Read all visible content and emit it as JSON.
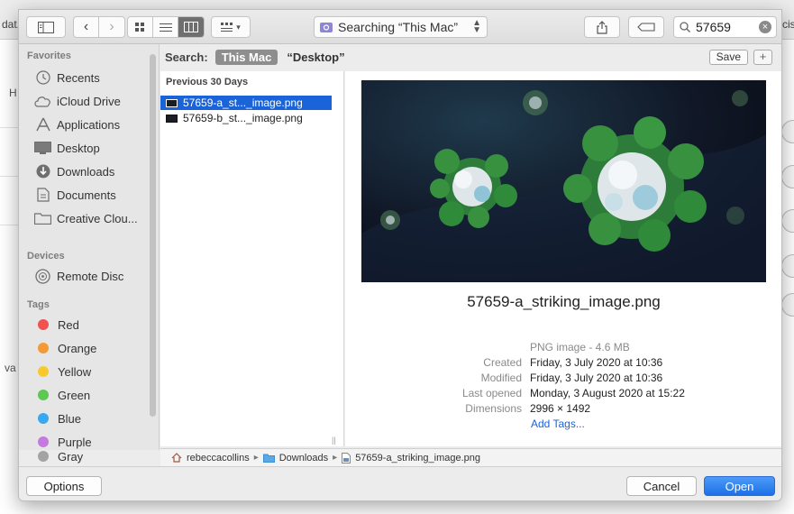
{
  "background": {
    "fragments": [
      "dat..",
      "cis"
    ],
    "left_fragments": [
      "H",
      "va"
    ]
  },
  "toolbar": {
    "location": "Searching “This Mac”",
    "search_value": "57659"
  },
  "sidebar": {
    "sections": [
      {
        "title": "Favorites",
        "items": [
          {
            "label": "Recents",
            "icon": "clock-icon"
          },
          {
            "label": "iCloud Drive",
            "icon": "cloud-icon"
          },
          {
            "label": "Applications",
            "icon": "applications-icon"
          },
          {
            "label": "Desktop",
            "icon": "desktop-icon"
          },
          {
            "label": "Downloads",
            "icon": "download-icon"
          },
          {
            "label": "Documents",
            "icon": "document-icon"
          },
          {
            "label": "Creative Clou...",
            "icon": "folder-icon"
          }
        ]
      },
      {
        "title": "Devices",
        "items": [
          {
            "label": "Remote Disc",
            "icon": "disc-icon"
          }
        ]
      },
      {
        "title": "Tags",
        "items": [
          {
            "label": "Red",
            "color": "#f0524f"
          },
          {
            "label": "Orange",
            "color": "#f39a34"
          },
          {
            "label": "Yellow",
            "color": "#f6c92e"
          },
          {
            "label": "Green",
            "color": "#5dc853"
          },
          {
            "label": "Blue",
            "color": "#38a9f1"
          },
          {
            "label": "Purple",
            "color": "#c57ae0"
          },
          {
            "label": "Gray",
            "color": "#a3a3a3"
          }
        ]
      }
    ]
  },
  "scope": {
    "label": "Search:",
    "active": "This Mac",
    "other": "“Desktop”",
    "save_label": "Save",
    "add_label": "+"
  },
  "filelist": {
    "header": "Previous 30 Days",
    "files": [
      {
        "name": "57659-a_st..._image.png",
        "selected": true
      },
      {
        "name": "57659-b_st..._image.png",
        "selected": false
      }
    ]
  },
  "preview": {
    "filename": "57659-a_striking_image.png",
    "kind": "PNG image - 4.6 MB",
    "meta": [
      {
        "key": "Created",
        "value": "Friday, 3 July 2020 at 10:36"
      },
      {
        "key": "Modified",
        "value": "Friday, 3 July 2020 at 10:36"
      },
      {
        "key": "Last opened",
        "value": "Monday, 3 August 2020 at 15:22"
      },
      {
        "key": "Dimensions",
        "value": "2996 × 1492"
      }
    ],
    "add_tags": "Add Tags..."
  },
  "pathbar": {
    "items": [
      "rebeccacollins",
      "Downloads",
      "57659-a_striking_image.png"
    ]
  },
  "buttons": {
    "options": "Options",
    "cancel": "Cancel",
    "open": "Open"
  },
  "colors": {
    "accent": "#1a63d8",
    "primary_button": "#2f80ed"
  }
}
